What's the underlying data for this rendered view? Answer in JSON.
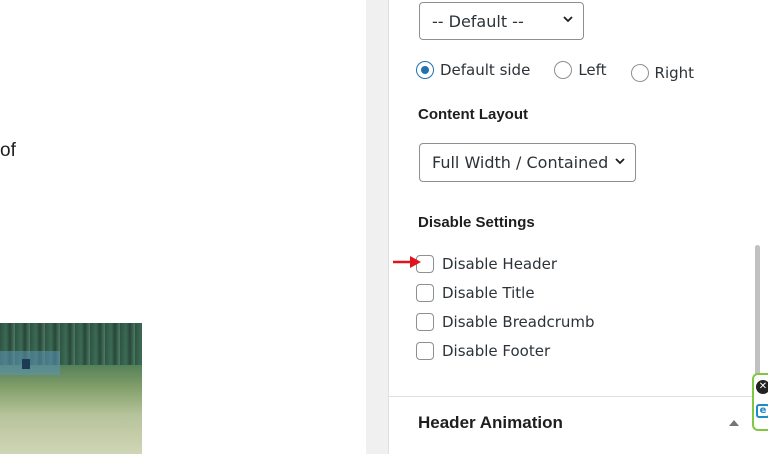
{
  "editor": {
    "fragment_text": "of"
  },
  "sidebar": {
    "sidebar_select": {
      "value": "-- Default --"
    },
    "radio_group": {
      "options": [
        {
          "label": "Default side",
          "checked": true
        },
        {
          "label": "Left",
          "checked": false
        },
        {
          "label": "Right",
          "checked": false
        }
      ]
    },
    "content_layout": {
      "label": "Content Layout",
      "value": "Full Width / Contained"
    },
    "disable_settings": {
      "label": "Disable Settings",
      "items": [
        {
          "label": "Disable Header",
          "checked": false
        },
        {
          "label": "Disable Title",
          "checked": false
        },
        {
          "label": "Disable Breadcrumb",
          "checked": false
        },
        {
          "label": "Disable Footer",
          "checked": false
        }
      ]
    },
    "header_animation": {
      "title": "Header Animation"
    }
  },
  "floating_widget": {
    "close_glyph": "✕",
    "badge_glyph": "e"
  },
  "colors": {
    "accent": "#2271b1",
    "annotation_arrow": "#e0141e",
    "widget_border": "#7ec846"
  }
}
